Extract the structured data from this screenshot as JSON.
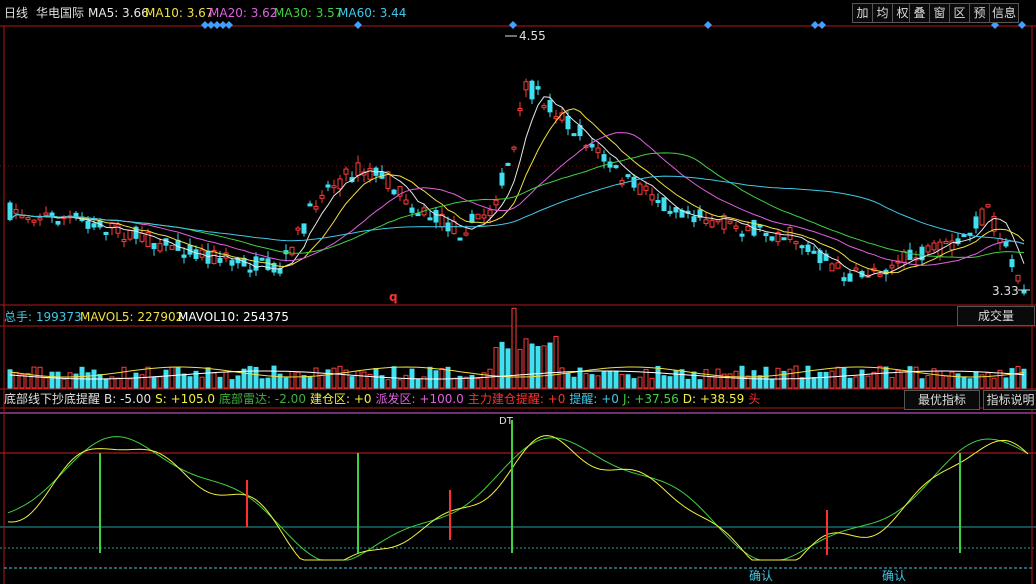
{
  "header": {
    "period": "日线",
    "stock_name": "华电国际",
    "ma": [
      {
        "label": "MA5: 3.66",
        "color": "#e8e8e8"
      },
      {
        "label": "MA10: 3.67",
        "color": "#f0e040"
      },
      {
        "label": "MA20: 3.62",
        "color": "#e060e0"
      },
      {
        "label": "MA30: 3.57",
        "color": "#40d040"
      },
      {
        "label": "MA60: 3.44",
        "color": "#40c8e8"
      }
    ],
    "toolbar": [
      "加",
      "均",
      "权",
      "叠",
      "窗",
      "区",
      "预",
      "信息"
    ]
  },
  "price_panel": {
    "high_label": "4.55",
    "low_label": "3.33",
    "marker": "q",
    "price_range": [
      3.28,
      4.62
    ]
  },
  "volume_panel": {
    "legend": [
      {
        "label": "总手: 199373",
        "color": "#40c8e8"
      },
      {
        "label": "MAVOL5: 227902",
        "color": "#f0e040"
      },
      {
        "label": "MAVOL10: 254375",
        "color": "#ffffff"
      }
    ],
    "button": "成交量"
  },
  "indicator_panel": {
    "legend": [
      {
        "label": "底部线下抄底提醒",
        "color": "#e0e0e0"
      },
      {
        "label": "B: -5.00",
        "color": "#e0e0e0"
      },
      {
        "label": "S: +105.0",
        "color": "#f0f040"
      },
      {
        "label": "底部雷达: -2.00",
        "color": "#40b040"
      },
      {
        "label": "建仓区: +0",
        "color": "#f0f040"
      },
      {
        "label": "派发区: +100.0",
        "color": "#e060e0"
      },
      {
        "label": "主力建仓提醒: +0",
        "color": "#ff3030"
      },
      {
        "label": "提醒: +0",
        "color": "#40c8e8"
      },
      {
        "label": "J: +37.56",
        "color": "#40d040"
      },
      {
        "label": "D: +38.59",
        "color": "#f0f040"
      },
      {
        "label": "头",
        "color": "#ff3030"
      }
    ],
    "buttons": [
      "最优指标",
      "指标说明"
    ],
    "signals": {
      "buy": "B",
      "sell": "S",
      "top": "DT",
      "confirm": "确认"
    }
  },
  "colors": {
    "up": "#ff3b3b",
    "down": "#40e0f0",
    "grid": "#7a1010",
    "axis": "#b01818"
  }
}
